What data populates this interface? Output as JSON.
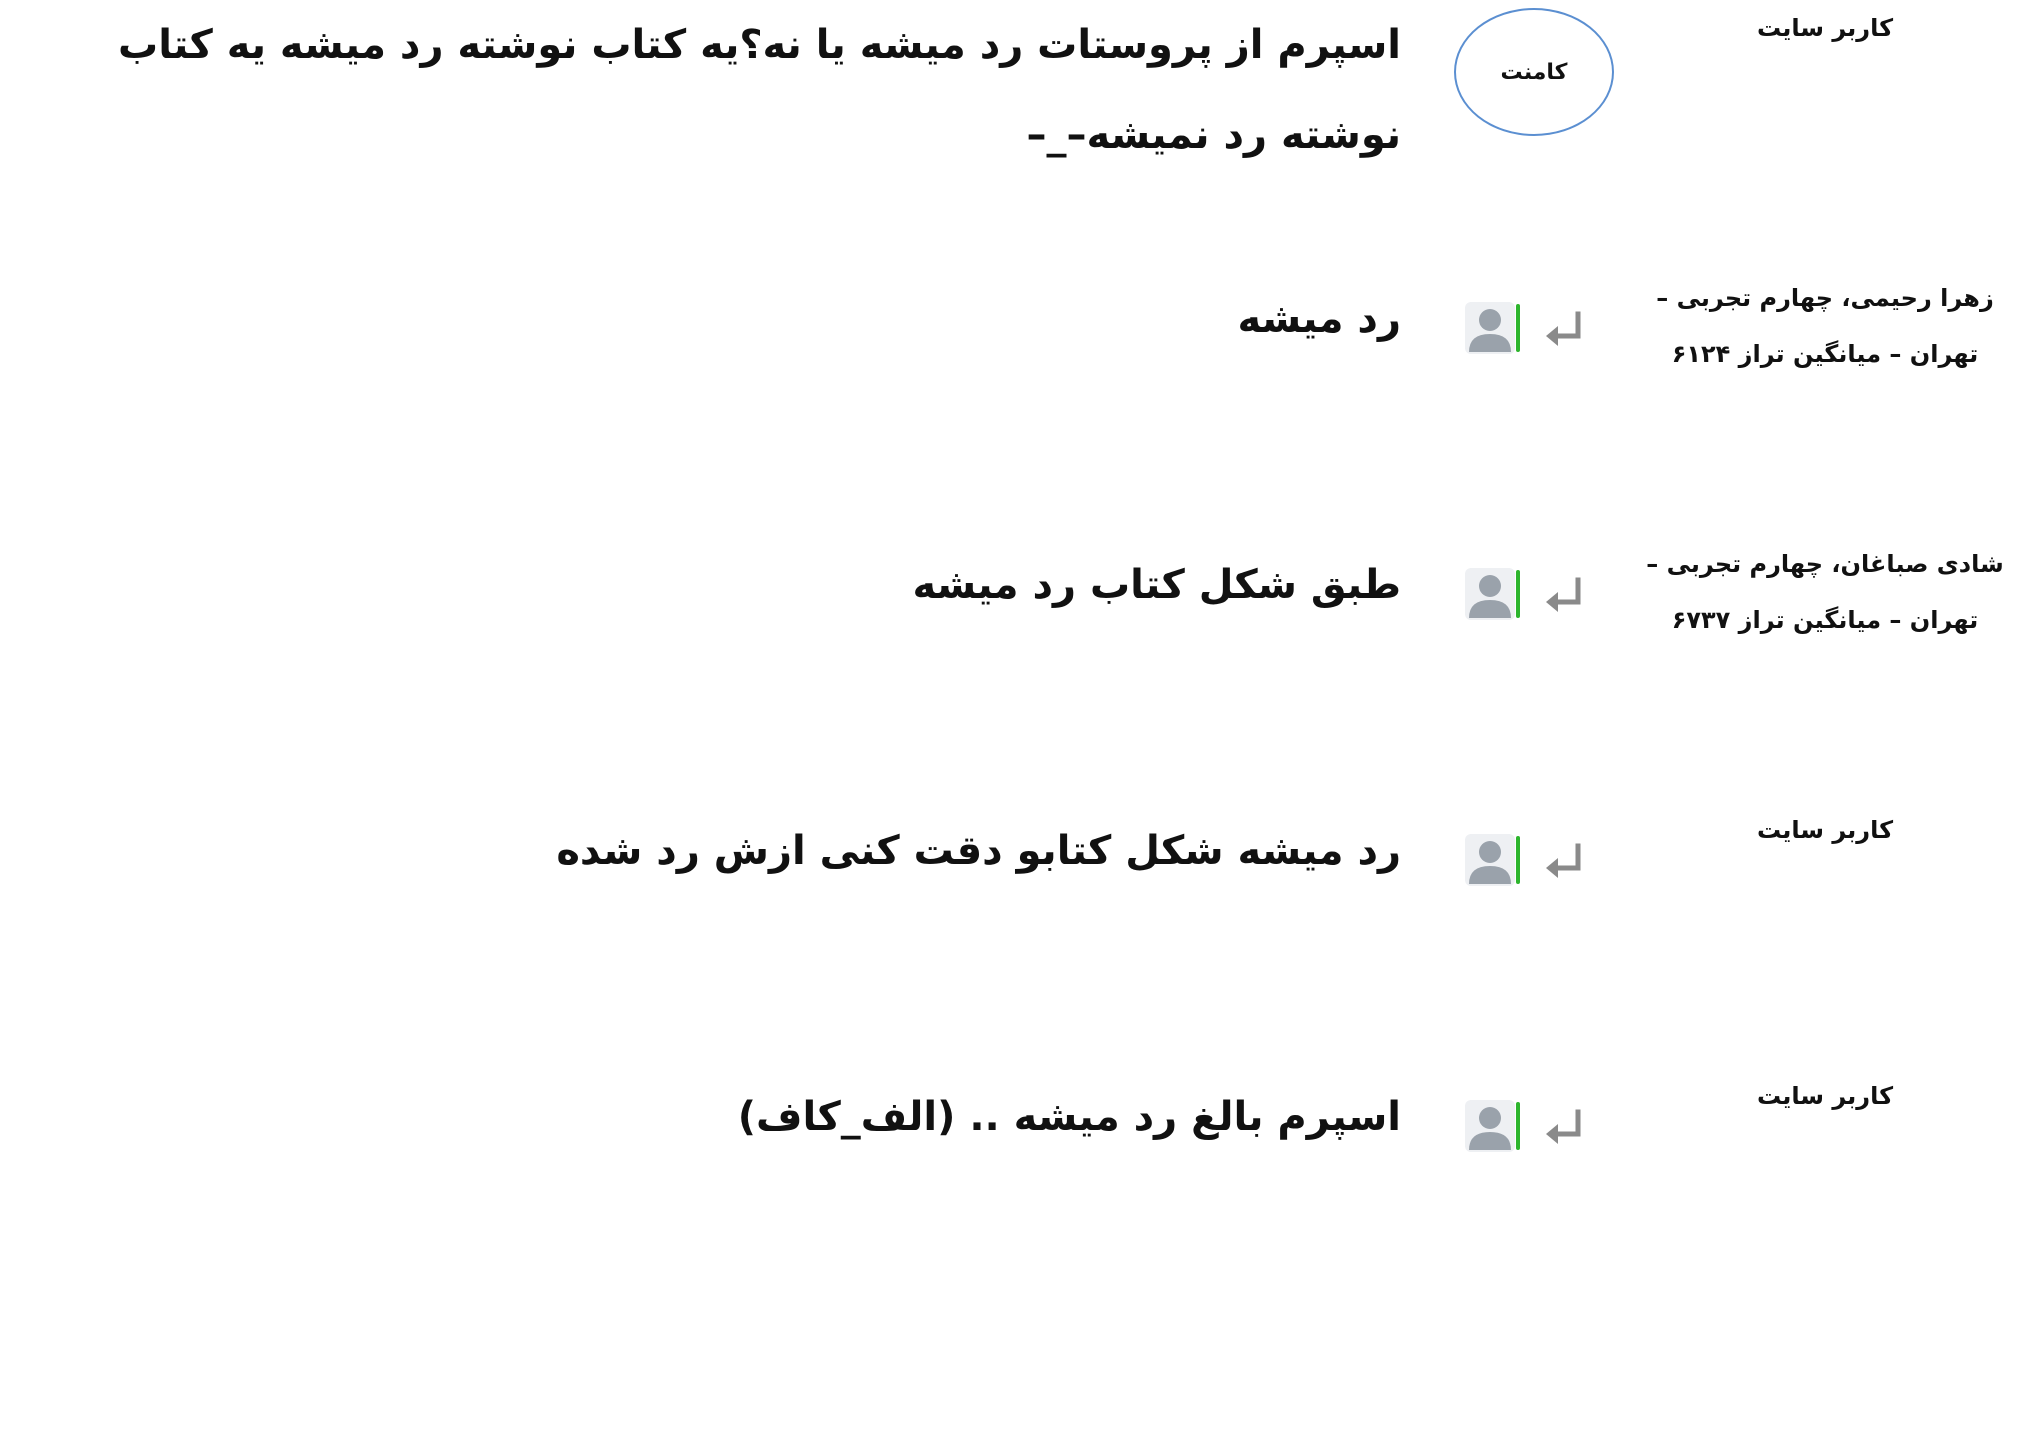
{
  "thread": {
    "root": {
      "author": "کاربر سایت",
      "badge_label": "کامنت",
      "text": "اسپرم از پروستات رد میشه یا نه؟یه کتاب نوشته رد میشه یه کتاب نوشته رد نمیشه–_–"
    },
    "replies": [
      {
        "author": "زهرا رحیمی، چهارم تجربی – تهران – میانگین تراز ۶۱۲۴",
        "text": "رد میشه"
      },
      {
        "author": "شادی صباغان، چهارم تجربی – تهران – میانگین تراز ۶۷۳۷",
        "text": "طبق شکل کتاب رد میشه"
      },
      {
        "author": "کاربر سایت",
        "text": "رد میشه شکل کتابو دقت کنی ازش رد شده"
      },
      {
        "author": "کاربر سایت",
        "text": "اسپرم بالغ رد میشه .. (الف_کاف)"
      }
    ]
  },
  "icons": {
    "reply": "reply-arrow-icon",
    "avatar": "default-user-avatar-icon"
  },
  "colors": {
    "badge_border": "#5b8fd1",
    "avatar_accent": "#2db52d",
    "avatar_gray": "#9aa2ab",
    "reply_arrow_gray": "#8a8a8a"
  }
}
